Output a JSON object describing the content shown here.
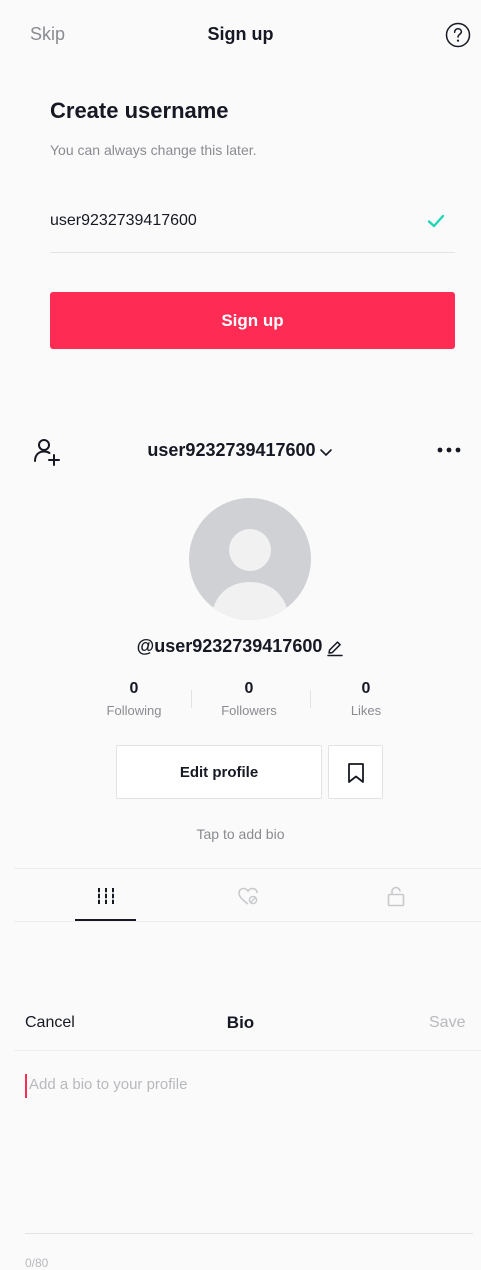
{
  "signup_screen": {
    "skip_label": "Skip",
    "title": "Sign up",
    "help_icon": "help-circle-icon",
    "heading": "Create username",
    "subheading": "You can always change this later.",
    "username_value": "user9232739417600",
    "username_valid_icon": "check-icon",
    "signup_button_label": "Sign up"
  },
  "profile_screen": {
    "add_user_icon": "add-user-icon",
    "username": "user9232739417600",
    "more_icon": "more-horizontal-icon",
    "handle": "@user9232739417600",
    "stats": [
      {
        "value": "0",
        "label": "Following"
      },
      {
        "value": "0",
        "label": "Followers"
      },
      {
        "value": "0",
        "label": "Likes"
      }
    ],
    "edit_profile_label": "Edit profile",
    "bookmark_icon": "bookmark-icon",
    "tap_to_add_bio": "Tap to add bio",
    "tabs": [
      {
        "icon": "grid-icon",
        "active": true
      },
      {
        "icon": "liked-hidden-icon",
        "active": false
      },
      {
        "icon": "lock-icon",
        "active": false
      }
    ]
  },
  "bio_screen": {
    "cancel_label": "Cancel",
    "title": "Bio",
    "save_label": "Save",
    "placeholder": "Add a bio to your profile",
    "char_count": "0/80"
  },
  "colors": {
    "accent": "#fe2c55",
    "success": "#20d5b5",
    "muted_text": "#8a8b91"
  }
}
